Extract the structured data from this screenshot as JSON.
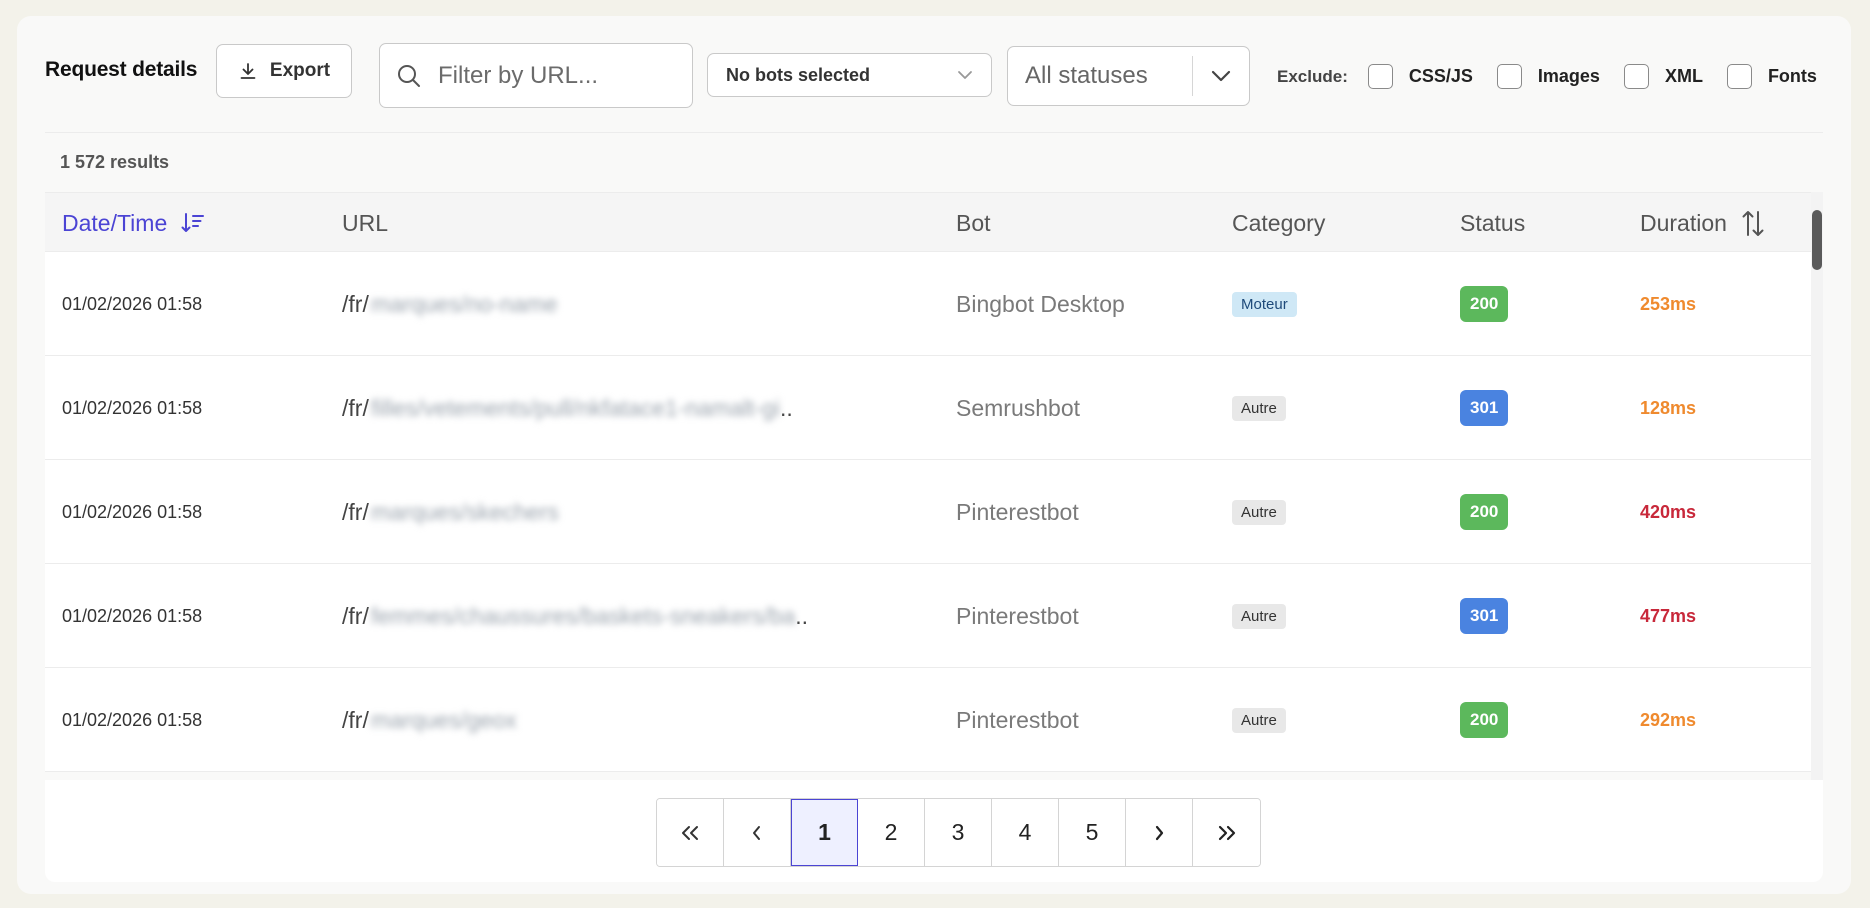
{
  "toolbar": {
    "title": "Request details",
    "export_label": "Export",
    "search_placeholder": "Filter by URL...",
    "bots_select": "No bots selected",
    "status_select": "All statuses",
    "exclude_label": "Exclude:",
    "exclude_options": [
      "CSS/JS",
      "Images",
      "XML",
      "Fonts"
    ]
  },
  "results_count": "1 572 results",
  "table": {
    "columns": [
      "Date/Time",
      "URL",
      "Bot",
      "Category",
      "Status",
      "Duration"
    ],
    "rows": [
      {
        "date": "01/02/2026 01:58",
        "url_prefix": "/fr/",
        "url_rest": "marques/no-name",
        "url_ellipsis": "",
        "bot": "Bingbot Desktop",
        "category": "Moteur",
        "status": "200",
        "duration": "253ms",
        "duration_color": "#ef8a2e"
      },
      {
        "date": "01/02/2026 01:58",
        "url_prefix": "/fr/",
        "url_rest": "filles/vetements/pull/nkfatace1-namalt-gi",
        "url_ellipsis": "..",
        "bot": "Semrushbot",
        "category": "Autre",
        "status": "301",
        "duration": "128ms",
        "duration_color": "#ef8a2e"
      },
      {
        "date": "01/02/2026 01:58",
        "url_prefix": "/fr/",
        "url_rest": "marques/skechers",
        "url_ellipsis": "",
        "bot": "Pinterestbot",
        "category": "Autre",
        "status": "200",
        "duration": "420ms",
        "duration_color": "#c8283a"
      },
      {
        "date": "01/02/2026 01:58",
        "url_prefix": "/fr/",
        "url_rest": "femmes/chaussures/baskets-sneakers/ba",
        "url_ellipsis": "..",
        "bot": "Pinterestbot",
        "category": "Autre",
        "status": "301",
        "duration": "477ms",
        "duration_color": "#c8283a"
      },
      {
        "date": "01/02/2026 01:58",
        "url_prefix": "/fr/",
        "url_rest": "marques/geox",
        "url_ellipsis": "",
        "bot": "Pinterestbot",
        "category": "Autre",
        "status": "200",
        "duration": "292ms",
        "duration_color": "#ef8a2e"
      }
    ]
  },
  "pagination": {
    "first": "«",
    "prev": "‹",
    "pages": [
      "1",
      "2",
      "3",
      "4",
      "5"
    ],
    "active": "1",
    "next": "›",
    "last": "»"
  },
  "colors": {
    "accent": "#4b44d4",
    "status_200": "#5cb85c",
    "status_301": "#4a83e0",
    "duration_warn": "#ef8a2e",
    "duration_slow": "#c8283a"
  }
}
